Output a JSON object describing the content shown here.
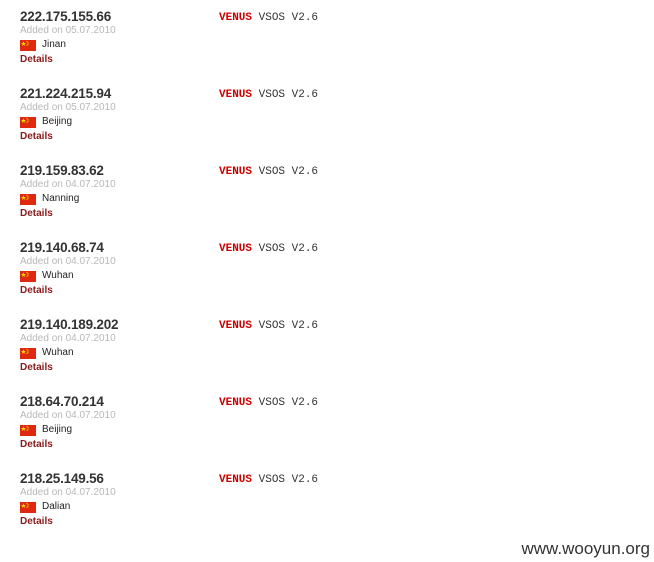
{
  "results": [
    {
      "ip": "222.175.155.66",
      "added": "Added on 05.07.2010",
      "city": "Jinan",
      "details": "Details",
      "brand": "VENUS",
      "version": "VSOS V2.6"
    },
    {
      "ip": "221.224.215.94",
      "added": "Added on 05.07.2010",
      "city": "Beijing",
      "details": "Details",
      "brand": "VENUS",
      "version": "VSOS V2.6"
    },
    {
      "ip": "219.159.83.62",
      "added": "Added on 04.07.2010",
      "city": "Nanning",
      "details": "Details",
      "brand": "VENUS",
      "version": "VSOS V2.6"
    },
    {
      "ip": "219.140.68.74",
      "added": "Added on 04.07.2010",
      "city": "Wuhan",
      "details": "Details",
      "brand": "VENUS",
      "version": "VSOS V2.6"
    },
    {
      "ip": "219.140.189.202",
      "added": "Added on 04.07.2010",
      "city": "Wuhan",
      "details": "Details",
      "brand": "VENUS",
      "version": "VSOS V2.6"
    },
    {
      "ip": "218.64.70.214",
      "added": "Added on 04.07.2010",
      "city": "Beijing",
      "details": "Details",
      "brand": "VENUS",
      "version": "VSOS V2.6"
    },
    {
      "ip": "218.25.149.56",
      "added": "Added on 04.07.2010",
      "city": "Dalian",
      "details": "Details",
      "brand": "VENUS",
      "version": "VSOS V2.6"
    }
  ],
  "flag_icon": "china-flag-icon",
  "colors": {
    "brand_red": "#cc0000",
    "details_red": "#8b1a1a",
    "flag_red": "#de2910",
    "flag_star": "#ffde00"
  },
  "watermark": "www.wooyun.org"
}
